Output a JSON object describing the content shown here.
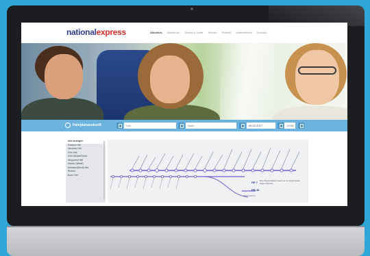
{
  "site": {
    "logo_part1": "national",
    "logo_part2": "express",
    "nav": [
      "Aktuelles",
      "Abenteuer",
      "Tickets & Tarife",
      "Service",
      "Freizeit",
      "Unternehmen",
      "Kontakt"
    ],
    "active_nav_index": 0
  },
  "search": {
    "title": "Fahrplanauskunft",
    "from_placeholder": "Von",
    "to_placeholder": "Nach",
    "date": "06.02.2017",
    "time": "17:00"
  },
  "route": {
    "stops_header": "Alle anzeigen",
    "stops": [
      "Koblenz Hbf",
      "Neuwied Hbf",
      "Köln Hbf",
      "Köln Messe/Deutz",
      "Wuppertal Hbf",
      "Hamm (Westf)",
      "Münster(Westf) Hbf",
      "Rheine",
      "Bonn Hbf"
    ],
    "lines": [
      "RE 7",
      "RB 48"
    ],
    "note": "Eine Regionalbahn stellt nur am Abendende Zügen benutzt"
  },
  "colors": {
    "accent": "#6db3df",
    "brand_blue": "#2a3f8f",
    "brand_red": "#d52b2b",
    "line_purple": "#6f5fc9",
    "background": "#2fa6d8"
  }
}
